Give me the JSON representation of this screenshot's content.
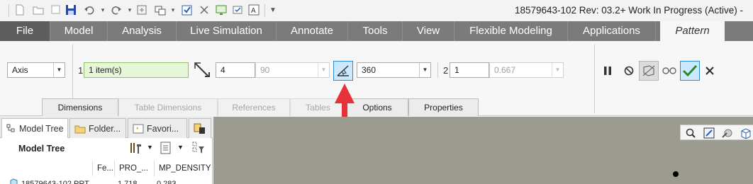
{
  "window": {
    "title": "18579643-102 Rev: 03.2+ Work In Progress  (Active) -"
  },
  "quick_access": {
    "icons": [
      "new-icon",
      "open-icon",
      "save-icon",
      "undo-icon",
      "redo-icon",
      "regenerate-icon",
      "windows-icon",
      "checkbox-icon",
      "close-window-icon",
      "display-icon",
      "annotation-icon",
      "text-style-icon",
      "more-icon"
    ]
  },
  "ribbon_tabs": [
    {
      "label": "File"
    },
    {
      "label": "Model"
    },
    {
      "label": "Analysis"
    },
    {
      "label": "Live Simulation"
    },
    {
      "label": "Annotate"
    },
    {
      "label": "Tools"
    },
    {
      "label": "View"
    },
    {
      "label": "Flexible Modeling"
    },
    {
      "label": "Applications"
    },
    {
      "label": "Pattern"
    }
  ],
  "pattern": {
    "type_value": "Axis",
    "dir1_label": "1",
    "dir1_collector": "1 item(s)",
    "member_count": "4",
    "angle_increment": "90",
    "angular_extent": "360",
    "dir2_label": "2",
    "dir2_count": "1",
    "dir2_spacing": "0.667"
  },
  "ribbon_subtabs": [
    {
      "label": "Dimensions"
    },
    {
      "label": "Table Dimensions"
    },
    {
      "label": "References"
    },
    {
      "label": "Tables"
    },
    {
      "label": "Options"
    },
    {
      "label": "Properties"
    }
  ],
  "panel": {
    "tabs": [
      {
        "label": "Model Tree"
      },
      {
        "label": "Folder..."
      },
      {
        "label": "Favori..."
      }
    ],
    "title": "Model Tree",
    "columns": [
      "Fe...",
      "PRO_...",
      "MP_DENSITY"
    ],
    "rows": [
      {
        "name": "18579643-102.PRT",
        "pro": "1.718",
        "density": "0.283"
      }
    ]
  },
  "colors": {
    "tab_bar": "#7b7b7b",
    "graphics_bg": "#9c9b8f",
    "arrow": "#e8323a",
    "collector_bg": "#e6f7d9"
  }
}
